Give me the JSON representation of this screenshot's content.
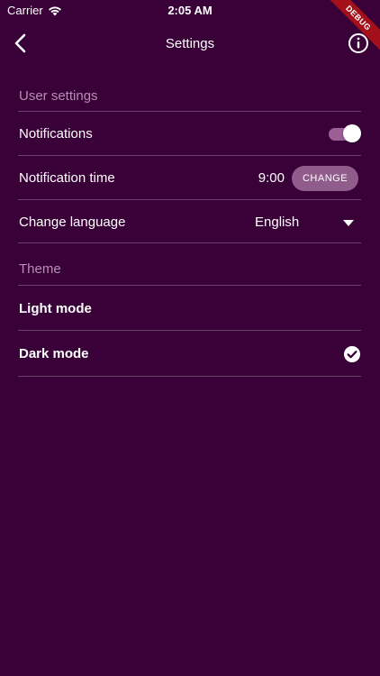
{
  "status_bar": {
    "carrier": "Carrier",
    "time": "2:05 AM",
    "wifi_icon": "wifi-icon"
  },
  "debug_banner": "DEBUG",
  "app_bar": {
    "title": "Settings",
    "back_icon": "chevron-left-icon",
    "info_icon": "info-icon"
  },
  "user_settings": {
    "header": "User settings",
    "notifications": {
      "label": "Notifications",
      "enabled": true
    },
    "notification_time": {
      "label": "Notification time",
      "value": "9:00",
      "button_label": "CHANGE"
    },
    "language": {
      "label": "Change language",
      "value": "English"
    }
  },
  "theme": {
    "header": "Theme",
    "options": [
      {
        "label": "Light mode",
        "selected": false
      },
      {
        "label": "Dark mode",
        "selected": true
      }
    ]
  },
  "colors": {
    "background": "#3a0138",
    "accent": "#8f5c8b",
    "section_header": "#b58fb4",
    "divider": "#6a4268",
    "debug_banner": "#a3101a"
  }
}
